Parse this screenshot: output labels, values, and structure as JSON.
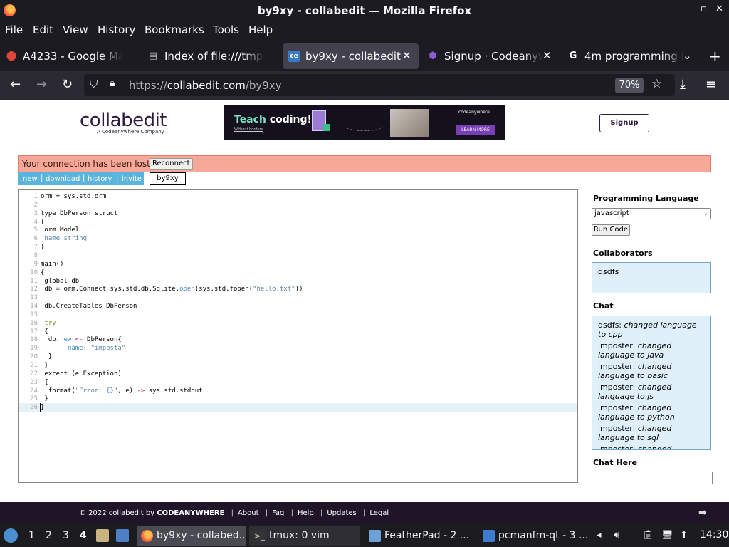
{
  "window": {
    "title": "by9xy - collabedit — Mozilla Firefox",
    "controls": [
      "–",
      "▫",
      "✕"
    ]
  },
  "menu": [
    "File",
    "Edit",
    "View",
    "History",
    "Bookmarks",
    "Tools",
    "Help"
  ],
  "tabs": [
    {
      "label": "A4233 - Google Ma",
      "icon": "map-pin-icon"
    },
    {
      "label": "Index of file:///tmp/",
      "icon": "file-icon"
    },
    {
      "label": "by9xy - collabedit",
      "icon": "collabedit-icon",
      "active": true
    },
    {
      "label": "Signup · Codeanyw",
      "icon": "codeanywhere-icon"
    },
    {
      "label": "4m programming l",
      "icon": "google-icon"
    }
  ],
  "nav": {
    "url_scheme": "https://",
    "url_host": "collabedit.com",
    "url_path": "/by9xy",
    "zoom": "70%"
  },
  "header": {
    "logo": "collabedit",
    "logo_sub": "A Codeanywhere Company",
    "ad_teach_pre": "Teach",
    "ad_teach_post": " coding!",
    "ad_small": "Without borders",
    "ad_brand": "codeanywhere",
    "ad_learn": "LEARN MORE",
    "signup": "Signup"
  },
  "alert": {
    "message": "Your connection has been lost",
    "reconnect": "Reconnect"
  },
  "links": [
    "new",
    "download",
    "history",
    "invite"
  ],
  "doc_name": "by9xy",
  "code": [
    [
      [
        "orm = sys.std.orm",
        ""
      ]
    ],
    [],
    [
      [
        "type DbPerson struct",
        ""
      ]
    ],
    [
      [
        "{",
        ""
      ]
    ],
    [
      [
        " orm.Model",
        ""
      ]
    ],
    [
      [
        " name string",
        "str"
      ]
    ],
    [
      [
        "}",
        ""
      ]
    ],
    [],
    [
      [
        "main()",
        ""
      ]
    ],
    [
      [
        "{",
        ""
      ]
    ],
    [
      [
        " global db",
        ""
      ]
    ],
    [
      [
        " db = orm.Connect sys.std.db.Sqlite.",
        ""
      ],
      [
        "open",
        "fn"
      ],
      [
        "(sys.std.fopen(",
        ""
      ],
      [
        "\"hello.txt\"",
        "str"
      ],
      [
        "))",
        ""
      ]
    ],
    [],
    [
      [
        " db.CreateTables DbPerson",
        ""
      ]
    ],
    [],
    [
      [
        " try",
        "kw"
      ]
    ],
    [
      [
        " {",
        ""
      ]
    ],
    [
      [
        "  db.",
        ""
      ],
      [
        "new",
        "prop"
      ],
      [
        " ",
        ""
      ],
      [
        "<-",
        "op"
      ],
      [
        " DbPerson{",
        ""
      ]
    ],
    [
      [
        "       ",
        ""
      ],
      [
        "name",
        "prop"
      ],
      [
        ": ",
        ""
      ],
      [
        "\"imposta\"",
        "str"
      ]
    ],
    [
      [
        "  }",
        ""
      ]
    ],
    [
      [
        " }",
        ""
      ]
    ],
    [
      [
        " except (e Exception)",
        ""
      ]
    ],
    [
      [
        " {",
        ""
      ]
    ],
    [
      [
        "  format(",
        ""
      ],
      [
        "\"Error: {}\"",
        "str"
      ],
      [
        ", e) ",
        ""
      ],
      [
        "->",
        "op"
      ],
      [
        " sys.std.stdout",
        ""
      ]
    ],
    [
      [
        " }",
        ""
      ]
    ],
    [
      [
        "}",
        ""
      ]
    ]
  ],
  "sidebar": {
    "lang_heading": "Programming Language",
    "lang_value": "javascript",
    "run": "Run Code",
    "collab_heading": "Collaborators",
    "collaborators": [
      "dsdfs"
    ],
    "chat_heading": "Chat",
    "chat": [
      {
        "user": "dsdfs:",
        "text": "changed language to cpp"
      },
      {
        "user": "imposter:",
        "text": "changed language to java"
      },
      {
        "user": "imposter:",
        "text": "changed language to basic"
      },
      {
        "user": "imposter:",
        "text": "changed language to js"
      },
      {
        "user": "imposter:",
        "text": "changed language to python"
      },
      {
        "user": "imposter:",
        "text": "changed language to sql"
      },
      {
        "user": "imposter:",
        "text": "changed"
      }
    ],
    "chat_here": "Chat Here"
  },
  "footer": {
    "copy": "© 2022 collabedit by ",
    "brand": "CODEANYWHERE",
    "links": [
      "About",
      "Faq",
      "Help",
      "Updates",
      "Legal"
    ]
  },
  "taskbar": {
    "workspaces": [
      "1",
      "2",
      "3",
      "4"
    ],
    "active_workspace": "4",
    "tasks": [
      {
        "label": "by9xy - collabed...",
        "icon": "firefox-icon",
        "active": true
      },
      {
        "label": "tmux: 0 vim",
        "icon": "terminal-icon"
      },
      {
        "label": "FeatherPad - 2 ...",
        "icon": "featherpad-icon"
      },
      {
        "label": "pcmanfm-qt - 3 ...",
        "icon": "folder-icon"
      }
    ],
    "clock": "14:30"
  }
}
